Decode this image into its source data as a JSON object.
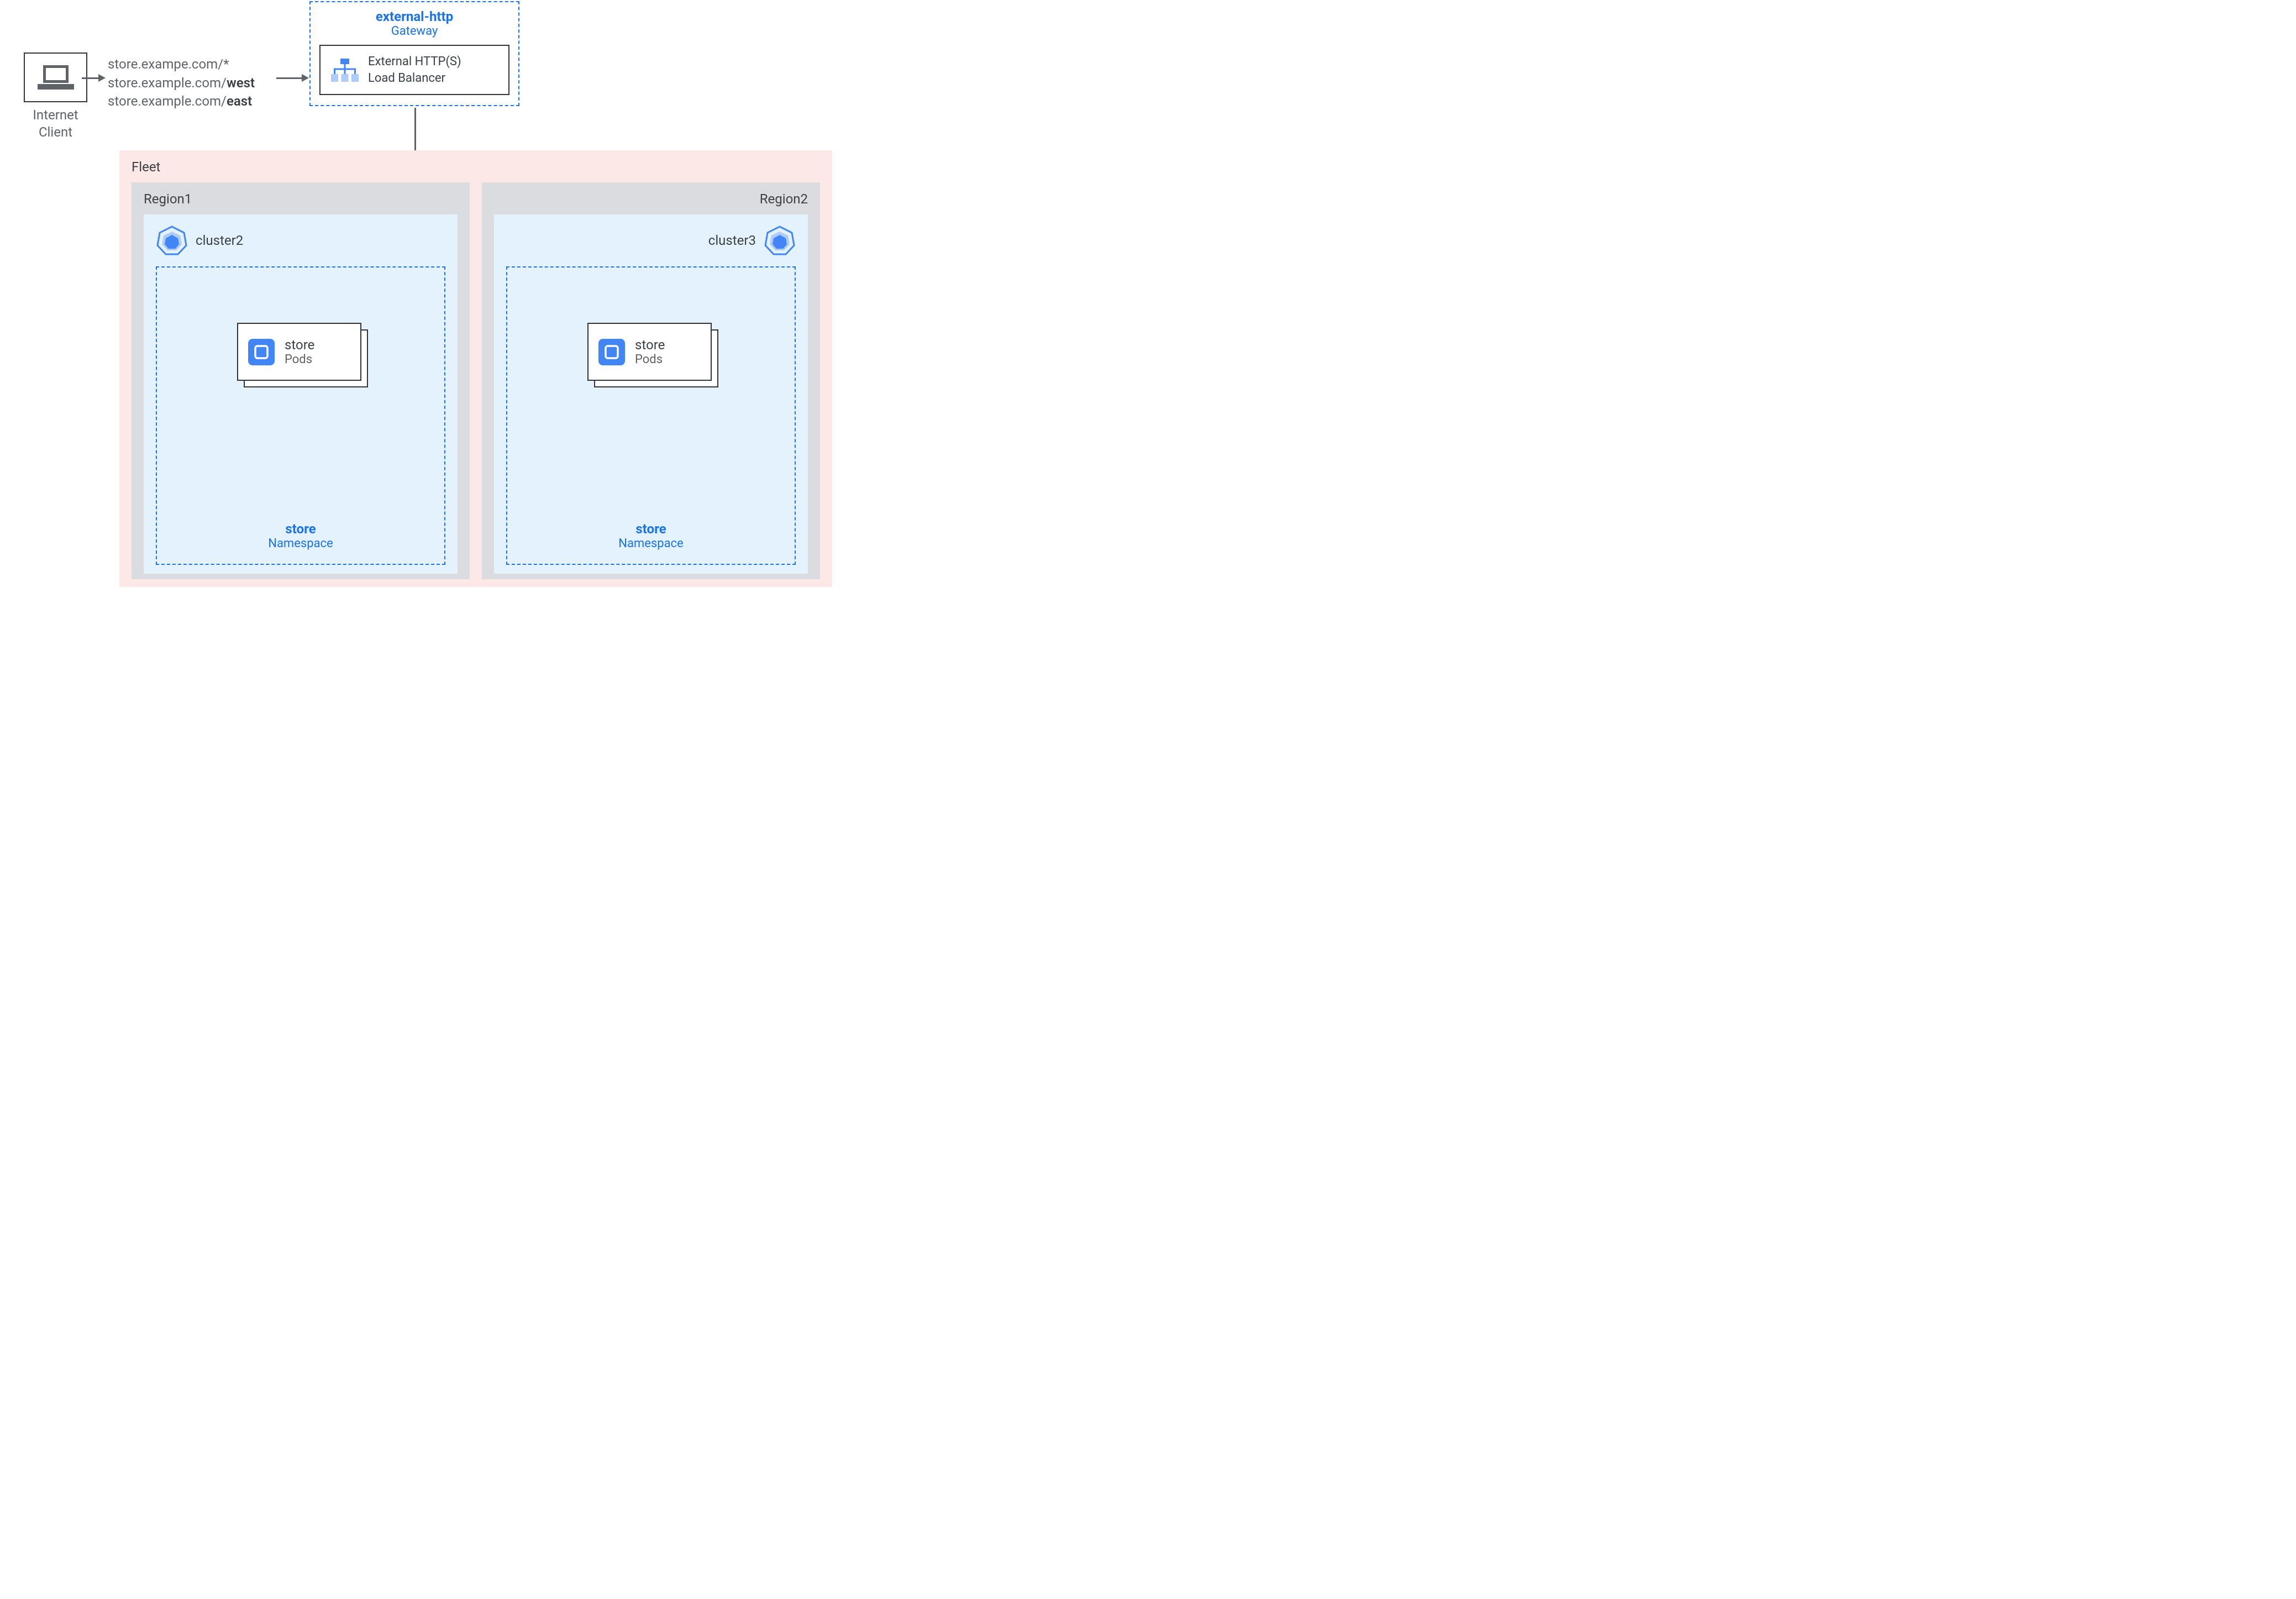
{
  "client": {
    "label_line1": "Internet",
    "label_line2": "Client"
  },
  "urls": {
    "line1_host": "store.exampe.com",
    "line1_path": "/*",
    "line2_host": "store.example.com/",
    "line2_path": "west",
    "line3_host": "store.example.com/",
    "line3_path": "east"
  },
  "gateway": {
    "name": "external-http",
    "type": "Gateway",
    "lb_line1": "External HTTP(S)",
    "lb_line2": "Load Balancer"
  },
  "fleet": {
    "label": "Fleet",
    "regions": [
      {
        "label": "Region1",
        "cluster_label": "cluster2",
        "namespace_name": "store",
        "namespace_type": "Namespace",
        "pods_name": "store",
        "pods_type": "Pods"
      },
      {
        "label": "Region2",
        "cluster_label": "cluster3",
        "namespace_name": "store",
        "namespace_type": "Namespace",
        "pods_name": "store",
        "pods_type": "Pods"
      }
    ]
  }
}
